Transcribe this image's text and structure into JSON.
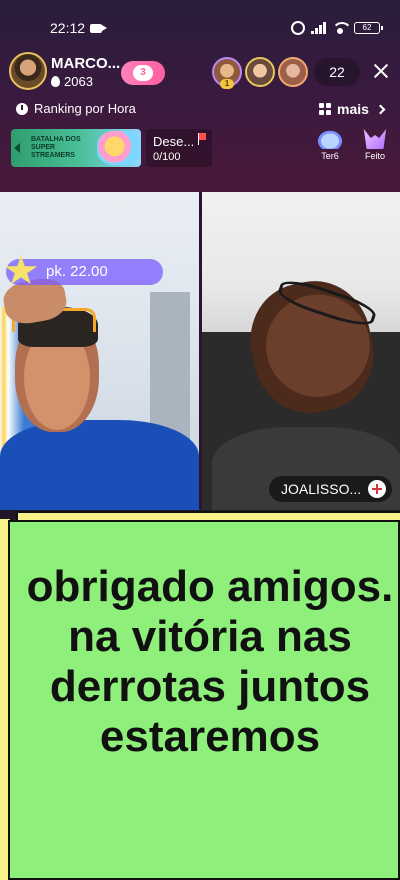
{
  "status_bar": {
    "time": "22:12",
    "battery": "62"
  },
  "host": {
    "name": "MARCO...",
    "fans": "2063",
    "follow_badge": "3"
  },
  "viewers": {
    "rank_label": "1",
    "count": "22"
  },
  "ranking": {
    "label": "Ranking por Hora"
  },
  "more": {
    "label": "mais"
  },
  "battle_banner": {
    "text": "BATALHA DOS SUPER STREAMERS"
  },
  "task": {
    "title": "Dese...",
    "progress": "0/100"
  },
  "events": [
    {
      "label": "Ter6"
    },
    {
      "label": "Feito"
    }
  ],
  "pk": {
    "label": "pk. 22.00"
  },
  "guest": {
    "name": "JOALISSO..."
  },
  "message": {
    "text": "obrigado amigos. na vitória nas derrotas juntos estaremos"
  },
  "colors": {
    "message_card": "#8ef07a",
    "accent_pink": "#ff5fa0",
    "pk_purple": "#785aff"
  }
}
